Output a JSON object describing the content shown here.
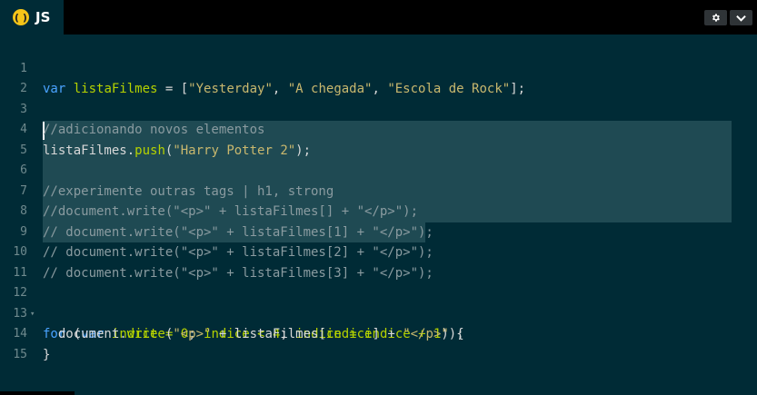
{
  "tab": {
    "badge": "( )",
    "label": "JS"
  },
  "toolbar": {
    "settings_icon": "gear-icon",
    "menu_icon": "chevron-down-icon"
  },
  "colors": {
    "background": "#002b36",
    "keyword": "#4aa3ff",
    "identifier": "#b5d200",
    "string": "#c9b86e",
    "comment": "#8a9ba0",
    "selection": "#1f4a53"
  },
  "editor": {
    "line_numbers": [
      "1",
      "2",
      "3",
      "4",
      "5",
      "6",
      "7",
      "8",
      "9",
      "10",
      "11",
      "12",
      "13",
      "14",
      "15"
    ],
    "lines": {
      "l1": [
        "var",
        " ",
        "listaFilmes",
        " = [",
        "\"Yesterday\"",
        ", ",
        "\"A chegada\"",
        ", ",
        "\"Escola de Rock\"",
        "];"
      ],
      "l3": "//adicionando novos elementos",
      "l4": [
        "listaFilmes",
        ".",
        "push",
        "(",
        "\"Harry Potter 2\"",
        ");"
      ],
      "l6": "//experimente outras tags | h1, strong",
      "l7": "//document.write(\"<p>\" + listaFilmes[] + \"</p>\");",
      "l8": "// document.write(\"<p>\" + listaFilmes[1] + \"</p>\");",
      "l9": "// document.write(\"<p>\" + listaFilmes[2] + \"</p>\");",
      "l10": "// document.write(\"<p>\" + listaFilmes[3] + \"</p>\");",
      "l12": [
        "for",
        " (",
        "var",
        " ",
        "indice",
        " = ",
        "0",
        "; ",
        "indice",
        " < ",
        "4",
        "; ",
        "indice",
        " = ",
        "indice",
        " + ",
        "1",
        ") {"
      ],
      "l13": [
        "  document.",
        "write",
        "(",
        "\"<p>\"",
        " + listaFilmes[",
        "indice",
        "] + ",
        "\"</p>\"",
        ");"
      ],
      "l14": "}"
    }
  }
}
